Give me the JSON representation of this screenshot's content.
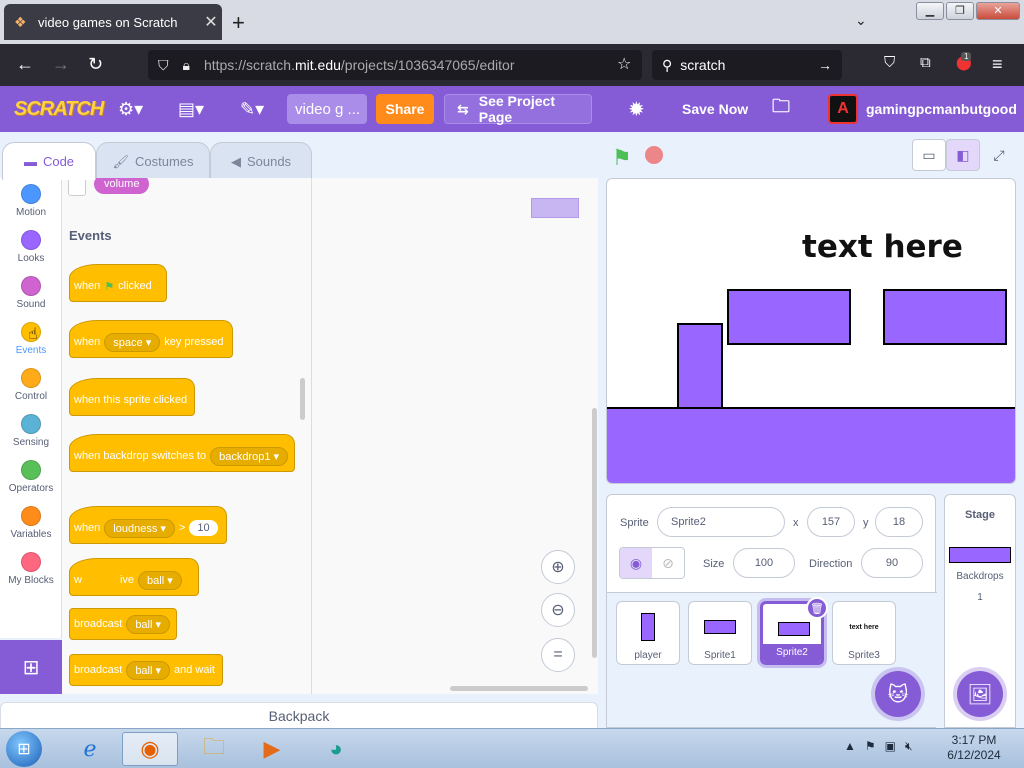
{
  "browser": {
    "tab_title": "video games on Scratch",
    "url_prefix": "https://scratch.",
    "url_host": "mit.edu",
    "url_path": "/projects/1036347065/editor",
    "search_text": "scratch",
    "extension_badge": "1"
  },
  "menubar": {
    "logo": "SCRATCH",
    "project_title": "video g ...",
    "share_label": "Share",
    "see_project_label": "See Project Page",
    "save_label": "Save Now",
    "username": "gamingpcmanbutgood",
    "accent_color": "#855cd6"
  },
  "editor_tabs": [
    {
      "label": "Code",
      "active": true
    },
    {
      "label": "Costumes",
      "active": false
    },
    {
      "label": "Sounds",
      "active": false
    }
  ],
  "categories": [
    {
      "label": "Motion",
      "color": "#4c97ff"
    },
    {
      "label": "Looks",
      "color": "#9966ff"
    },
    {
      "label": "Sound",
      "color": "#cf63cf"
    },
    {
      "label": "Events",
      "color": "#ffbf00"
    },
    {
      "label": "Control",
      "color": "#ffab19"
    },
    {
      "label": "Sensing",
      "color": "#5cb1d6"
    },
    {
      "label": "Operators",
      "color": "#59c059"
    },
    {
      "label": "Variables",
      "color": "#ff8c1a"
    },
    {
      "label": "My Blocks",
      "color": "#ff6680"
    }
  ],
  "palette": {
    "looks_reporter": "volume",
    "section_title": "Events",
    "blocks": {
      "flag_when": "when",
      "flag_clicked": "clicked",
      "key_when": "when",
      "key_value": "space",
      "key_pressed": "key pressed",
      "sprite_clicked": "when this sprite clicked",
      "backdrop_text": "when backdrop switches to",
      "backdrop_value": "backdrop1",
      "loudness_when": "when",
      "loudness_value": "loudness",
      "loudness_op": ">",
      "loudness_num": "10",
      "receive_w": "w",
      "receive_text": "ive",
      "receive_value": "ball",
      "broadcast_text": "broadcast",
      "broadcast_value": "ball",
      "broadcast_wait_text": "broadcast",
      "broadcast_wait_value": "ball",
      "broadcast_wait_suffix": "and wait"
    }
  },
  "backpack_label": "Backpack",
  "stage": {
    "text": "text here",
    "sprite_color": "#9966ff"
  },
  "sprite_info": {
    "sprite_label": "Sprite",
    "sprite_name": "Sprite2",
    "x_label": "x",
    "x_value": "157",
    "y_label": "y",
    "y_value": "18",
    "size_label": "Size",
    "size_value": "100",
    "direction_label": "Direction",
    "direction_value": "90"
  },
  "sprites": [
    {
      "name": "player"
    },
    {
      "name": "Sprite1"
    },
    {
      "name": "Sprite2",
      "selected": true
    },
    {
      "name": "Sprite3",
      "thumb_text": "text here"
    }
  ],
  "stage_pane": {
    "header": "Stage",
    "backdrops_label": "Backdrops",
    "backdrops_count": "1"
  },
  "taskbar": {
    "time": "3:17 PM",
    "date": "6/12/2024"
  }
}
